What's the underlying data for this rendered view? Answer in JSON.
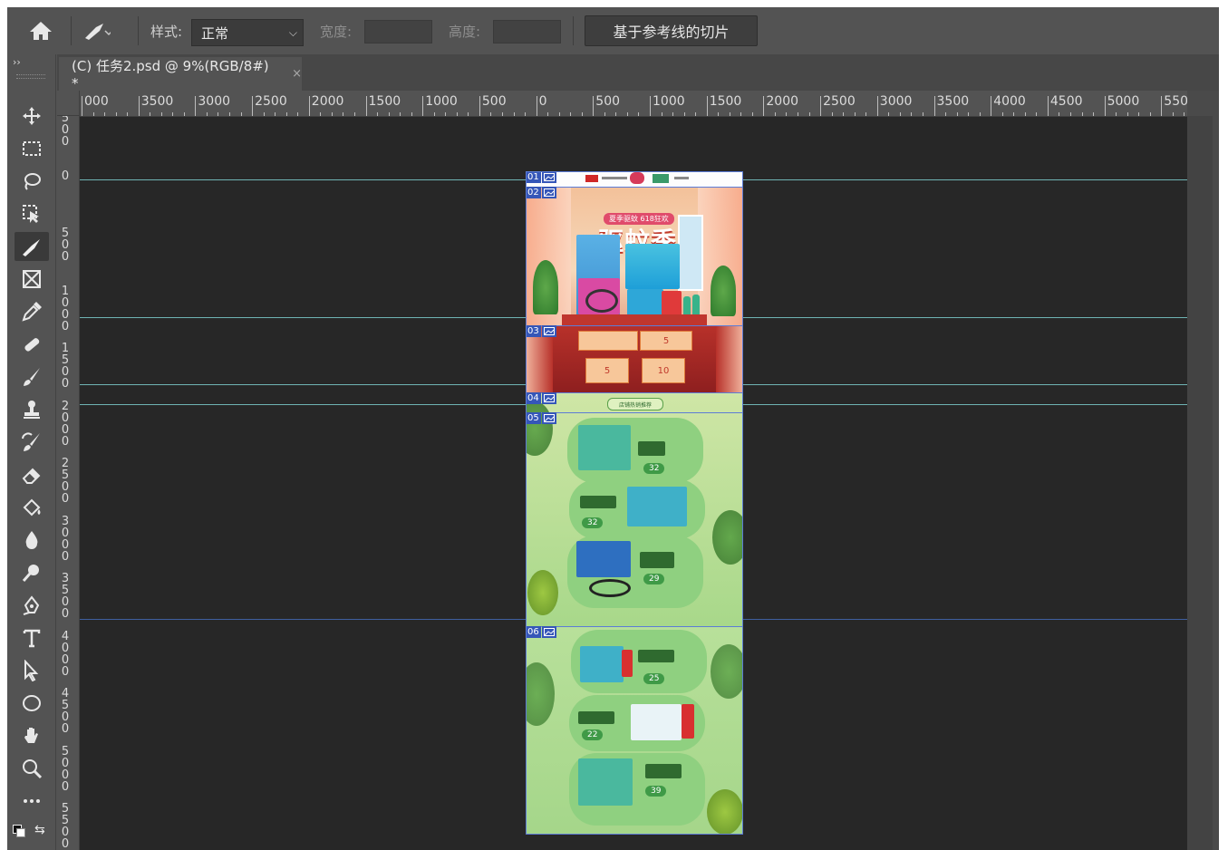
{
  "options_bar": {
    "style_label": "样式:",
    "style_value": "正常",
    "width_label": "宽度:",
    "width_value": "",
    "height_label": "高度:",
    "height_value": "",
    "slice_button": "基于参考线的切片"
  },
  "tab": {
    "title": "(C) 任务2.psd @ 9%(RGB/8#) *",
    "close": "×"
  },
  "collapse_label": "››",
  "hruler_labels": [
    "000",
    "3500",
    "3000",
    "2500",
    "2000",
    "1500",
    "1000",
    "500",
    "0",
    "500",
    "1000",
    "1500",
    "2000",
    "2500",
    "3000",
    "3500",
    "4000",
    "4500",
    "5000",
    "5500"
  ],
  "vruler_labels": [
    "500",
    "0",
    "500",
    "1000",
    "1500",
    "2000",
    "2500",
    "3000",
    "3500",
    "4000",
    "4500",
    "5000",
    "5500"
  ],
  "slices": [
    "01",
    "02",
    "03",
    "04",
    "05",
    "06"
  ],
  "artwork": {
    "banner_sub": "夏季驱蚊 618狂欢",
    "banner_title": "驱蚊季",
    "coupon_1": "5",
    "coupon_2": "5",
    "coupon_3": "10",
    "section_tag": "店铺热销推荐",
    "prices": [
      "32",
      "32",
      "29",
      "25",
      "22",
      "39"
    ]
  },
  "colors": {
    "app_bg": "#535353",
    "canvas_bg": "#272727",
    "guide_cyan": "#6fb3b3",
    "guide_blue": "#3f5f9f",
    "slice_blue": "#3556b8"
  }
}
